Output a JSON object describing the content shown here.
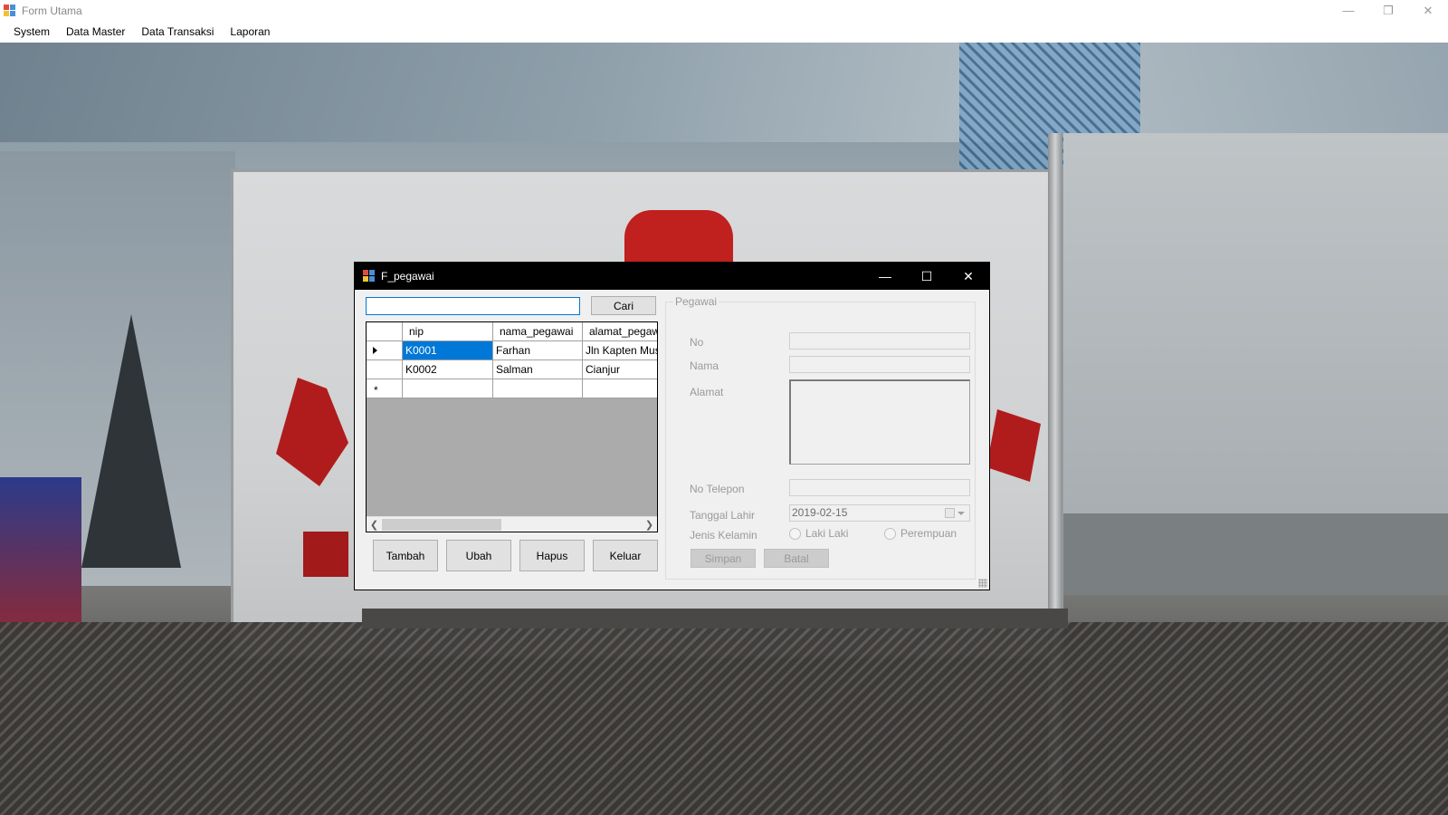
{
  "main_window": {
    "title": "Form Utama",
    "controls": {
      "minimize": "—",
      "restore": "❐",
      "close": "✕"
    }
  },
  "menu": [
    "System",
    "Data Master",
    "Data Transaksi",
    "Laporan"
  ],
  "child_window": {
    "title": "F_pegawai",
    "controls": {
      "minimize": "—",
      "maximize": "☐",
      "close": "✕"
    }
  },
  "search": {
    "value": "",
    "button_label": "Cari"
  },
  "grid": {
    "columns": [
      "nip",
      "nama_pegawai",
      "alamat_pegawai"
    ],
    "rows": [
      [
        "K0001",
        "Farhan",
        "Jln Kapten Musa"
      ],
      [
        "K0002",
        "Salman",
        "Cianjur"
      ]
    ],
    "new_row_marker": "*"
  },
  "actions": {
    "tambah": "Tambah",
    "ubah": "Ubah",
    "hapus": "Hapus",
    "keluar": "Keluar"
  },
  "form": {
    "group_title": "Pegawai",
    "labels": {
      "no": "No",
      "nama": "Nama",
      "alamat": "Alamat",
      "telepon": "No Telepon",
      "tanggal_lahir": "Tanggal Lahir",
      "jenis_kelamin": "Jenis Kelamin"
    },
    "tanggal_lahir_value": "2019-02-15",
    "gender_options": [
      "Laki Laki",
      "Perempuan"
    ],
    "simpan": "Simpan",
    "batal": "Batal"
  },
  "colors": {
    "selection": "#0078d7",
    "child_titlebar": "#000000",
    "disabled_text": "#9a9a9a"
  }
}
